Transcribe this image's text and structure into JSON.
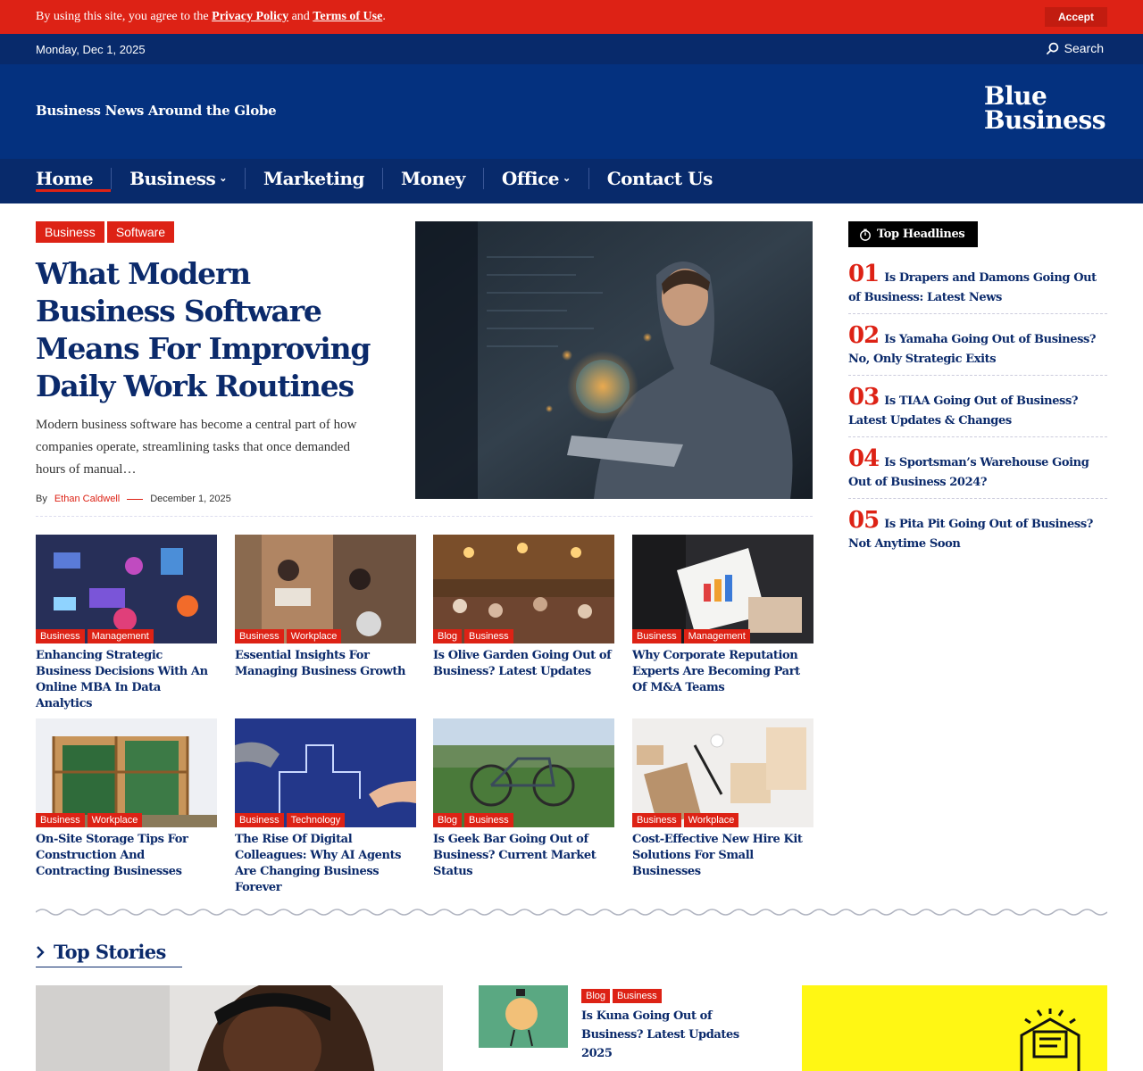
{
  "cookie": {
    "prefix": "By using this site, you agree to the ",
    "privacy": "Privacy Policy",
    "and": " and ",
    "terms": "Terms of Use",
    "suffix": ".",
    "accept": "Accept"
  },
  "topbar": {
    "date": "Monday, Dec 1, 2025",
    "search": "Search"
  },
  "masthead": {
    "tagline": "Business News Around the Globe",
    "logo_line1": "Blue",
    "logo_line2": "Business"
  },
  "nav": [
    "Home",
    "Business",
    "Marketing",
    "Money",
    "Office",
    "Contact Us"
  ],
  "hero": {
    "tags": [
      "Business",
      "Software"
    ],
    "title": "What Modern Business Software Means For Improving Daily Work Routines",
    "excerpt": "Modern business software has become a central part of how companies operate, streamlining tasks that once demanded hours of manual…",
    "by": "By",
    "author": "Ethan Caldwell",
    "date": "December 1, 2025"
  },
  "grid": [
    {
      "tags": [
        "Business",
        "Management"
      ],
      "title": "Enhancing Strategic Business Decisions With An Online MBA In Data Analytics"
    },
    {
      "tags": [
        "Business",
        "Workplace"
      ],
      "title": "Essential Insights For Managing Business Growth"
    },
    {
      "tags": [
        "Blog",
        "Business"
      ],
      "title": "Is Olive Garden Going Out of Business? Latest Updates"
    },
    {
      "tags": [
        "Business",
        "Management"
      ],
      "title": "Why Corporate Reputation Experts Are Becoming Part Of M&A Teams"
    },
    {
      "tags": [
        "Business",
        "Workplace"
      ],
      "title": "On-Site Storage Tips For Construction And Contracting Businesses"
    },
    {
      "tags": [
        "Business",
        "Technology"
      ],
      "title": "The Rise Of Digital Colleagues: Why AI Agents Are Changing Business Forever"
    },
    {
      "tags": [
        "Blog",
        "Business"
      ],
      "title": "Is Geek Bar Going Out of Business? Current Market Status"
    },
    {
      "tags": [
        "Business",
        "Workplace"
      ],
      "title": "Cost-Effective New Hire Kit Solutions For Small Businesses"
    }
  ],
  "sidebar": {
    "heading": "Top Headlines",
    "items": [
      {
        "num": "01",
        "title": "Is Drapers and Damons Going Out of Business: Latest News"
      },
      {
        "num": "02",
        "title": "Is Yamaha Going Out of Business? No, Only Strategic Exits"
      },
      {
        "num": "03",
        "title": "Is TIAA Going Out of Business? Latest Updates & Changes"
      },
      {
        "num": "04",
        "title": "Is Sportsman’s Warehouse Going Out of Business 2024?"
      },
      {
        "num": "05",
        "title": "Is Pita Pit Going Out of Business? Not Anytime Soon"
      }
    ]
  },
  "top_stories": {
    "heading": "Top Stories",
    "small_tags": [
      "Blog",
      "Business"
    ],
    "small_title": "Is Kuna Going Out of Business? Latest Updates 2025"
  },
  "colors": {
    "accent": "#dd2215",
    "navy": "#082a6b",
    "masthead": "#04317f"
  }
}
